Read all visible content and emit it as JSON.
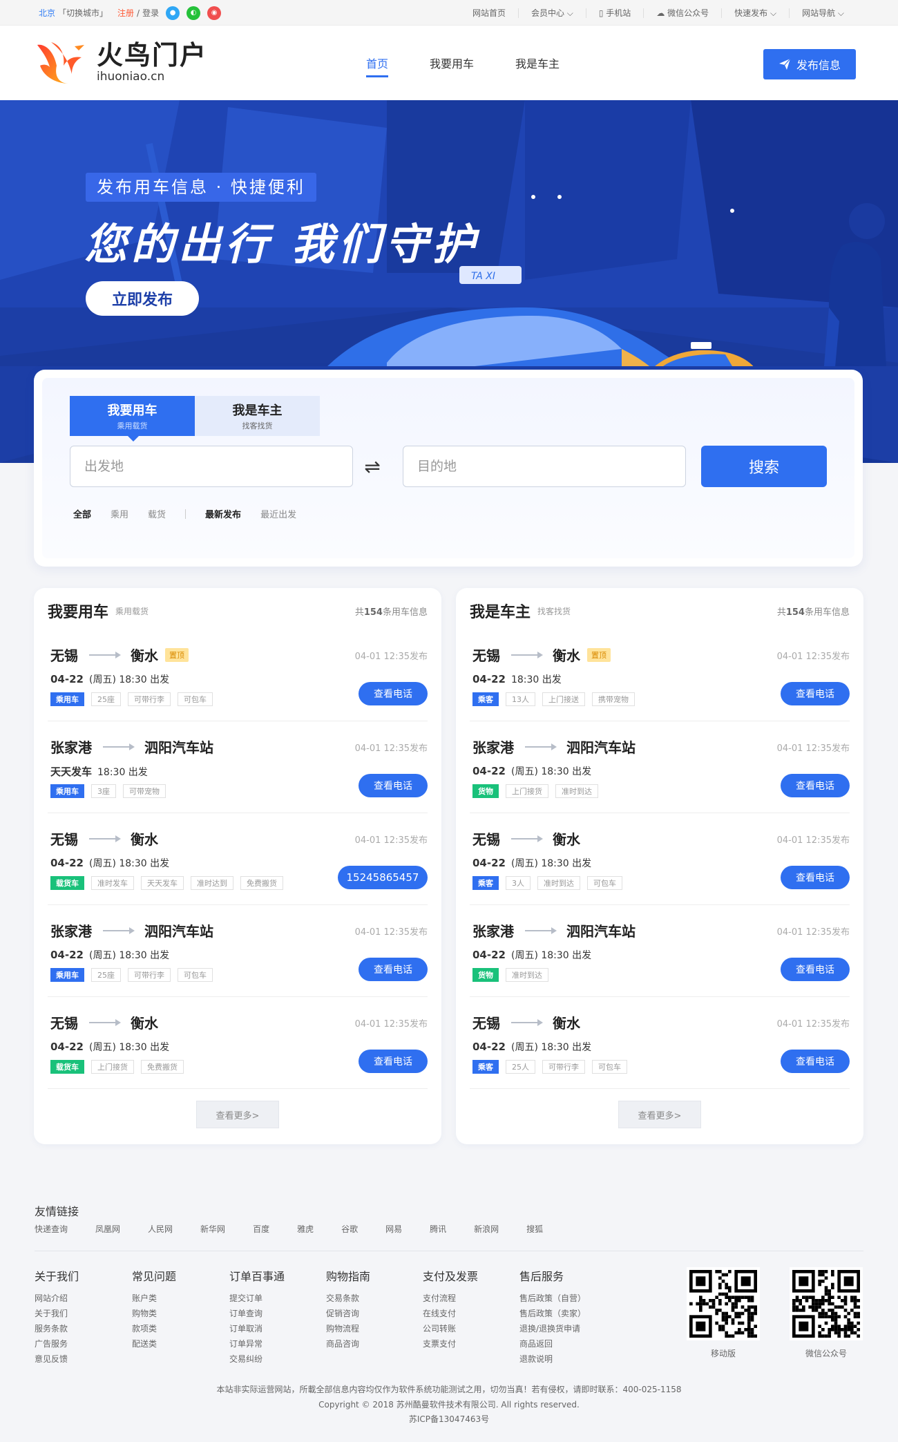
{
  "topbar": {
    "city": "北京",
    "switch_city": "「切换城市」",
    "register": "注册",
    "slash": "/",
    "login": "登录",
    "links": [
      "网站首页",
      "会员中心 ⌵",
      "手机站",
      "微信公众号",
      "快速发布 ⌵",
      "网站导航 ⌵"
    ]
  },
  "header": {
    "logo_main": "火鸟门户",
    "logo_sub": "ihuoniao.cn",
    "nav": [
      "首页",
      "我要用车",
      "我是车主"
    ],
    "publish_button": "发布信息"
  },
  "banner": {
    "tag": "发布用车信息 · 快捷便利",
    "title": "您的出行 我们守护",
    "button": "立即发布",
    "taxi_sign": "TA XI"
  },
  "search": {
    "tab_active_title": "我要用车",
    "tab_active_sub": "乘用载货",
    "tab_other_title": "我是车主",
    "tab_other_sub": "找客找货",
    "from_placeholder": "出发地",
    "to_placeholder": "目的地",
    "swap_icon": "⇌",
    "button": "搜索",
    "filters_type": [
      "全部",
      "乘用",
      "载货"
    ],
    "filters_sort": [
      "最新发布",
      "最近出发"
    ]
  },
  "left_panel": {
    "title": "我要用车",
    "subtitle": "乘用载货",
    "count_pre": "共",
    "count": "154",
    "count_post": "条用车信息",
    "more": "查看更多>",
    "rows": [
      {
        "from": "无锡",
        "to": "衡水",
        "top": "置顶",
        "time": "04-01  12:35发布",
        "date": "04-22",
        "detail": "(周五) 18:30 出发",
        "type": "乘用车",
        "type_color": "blue",
        "tags": [
          "25座",
          "可带行李",
          "可包车"
        ],
        "btn": "查看电话",
        "wide": false
      },
      {
        "from": "张家港",
        "to": "泗阳汽车站",
        "top": "",
        "time": "04-01  12:35发布",
        "date": "天天发车",
        "detail": "18:30 出发",
        "type": "乘用车",
        "type_color": "blue",
        "tags": [
          "3座",
          "可带宠物"
        ],
        "btn": "查看电话",
        "wide": false
      },
      {
        "from": "无锡",
        "to": "衡水",
        "top": "",
        "time": "04-01  12:35发布",
        "date": "04-22",
        "detail": "(周五) 18:30 出发",
        "type": "载货车",
        "type_color": "green",
        "tags": [
          "准时发车",
          "天天发车",
          "准时达到",
          "免费搬货"
        ],
        "btn": "15245865457",
        "wide": true
      },
      {
        "from": "张家港",
        "to": "泗阳汽车站",
        "top": "",
        "time": "04-01  12:35发布",
        "date": "04-22",
        "detail": "(周五) 18:30 出发",
        "type": "乘用车",
        "type_color": "blue",
        "tags": [
          "25座",
          "可带行李",
          "可包车"
        ],
        "btn": "查看电话",
        "wide": false
      },
      {
        "from": "无锡",
        "to": "衡水",
        "top": "",
        "time": "04-01  12:35发布",
        "date": "04-22",
        "detail": "(周五) 18:30 出发",
        "type": "载货车",
        "type_color": "green",
        "tags": [
          "上门接货",
          "免费搬货"
        ],
        "btn": "查看电话",
        "wide": false
      }
    ]
  },
  "right_panel": {
    "title": "我是车主",
    "subtitle": "找客找货",
    "count_pre": "共",
    "count": "154",
    "count_post": "条用车信息",
    "more": "查看更多>",
    "rows": [
      {
        "from": "无锡",
        "to": "衡水",
        "top": "置顶",
        "time": "04-01  12:35发布",
        "date": "04-22",
        "detail": "18:30 出发",
        "type": "乘客",
        "type_color": "blue",
        "tags": [
          "13人",
          "上门接送",
          "携带宠物"
        ],
        "btn": "查看电话",
        "wide": false
      },
      {
        "from": "张家港",
        "to": "泗阳汽车站",
        "top": "",
        "time": "04-01  12:35发布",
        "date": "04-22",
        "detail": "(周五) 18:30 出发",
        "type": "货物",
        "type_color": "green",
        "tags": [
          "上门接货",
          "准时到达"
        ],
        "btn": "查看电话",
        "wide": false
      },
      {
        "from": "无锡",
        "to": "衡水",
        "top": "",
        "time": "04-01  12:35发布",
        "date": "04-22",
        "detail": "(周五) 18:30 出发",
        "type": "乘客",
        "type_color": "blue",
        "tags": [
          "3人",
          "准时到达",
          "可包车"
        ],
        "btn": "查看电话",
        "wide": false
      },
      {
        "from": "张家港",
        "to": "泗阳汽车站",
        "top": "",
        "time": "04-01  12:35发布",
        "date": "04-22",
        "detail": "(周五) 18:30 出发",
        "type": "货物",
        "type_color": "green",
        "tags": [
          "准时到达"
        ],
        "btn": "查看电话",
        "wide": false
      },
      {
        "from": "无锡",
        "to": "衡水",
        "top": "",
        "time": "04-01  12:35发布",
        "date": "04-22",
        "detail": "(周五) 18:30 出发",
        "type": "乘客",
        "type_color": "blue",
        "tags": [
          "25人",
          "可带行李",
          "可包车"
        ],
        "btn": "查看电话",
        "wide": false
      }
    ]
  },
  "footer": {
    "friend_links_title": "友情链接",
    "friend_links": [
      "快递查询",
      "凤凰网",
      "人民网",
      "新华网",
      "百度",
      "雅虎",
      "谷歌",
      "网易",
      "腾讯",
      "新浪网",
      "搜狐"
    ],
    "columns": [
      {
        "title": "关于我们",
        "items": [
          "网站介绍",
          "关于我们",
          "服务条款",
          "广告服务",
          "意见反馈"
        ]
      },
      {
        "title": "常见问题",
        "items": [
          "账户类",
          "购物类",
          "款项类",
          "配送类"
        ]
      },
      {
        "title": "订单百事通",
        "items": [
          "提交订单",
          "订单查询",
          "订单取消",
          "订单异常",
          "交易纠纷"
        ]
      },
      {
        "title": "购物指南",
        "items": [
          "交易条款",
          "促销咨询",
          "购物流程",
          "商品咨询"
        ]
      },
      {
        "title": "支付及发票",
        "items": [
          "支付流程",
          "在线支付",
          "公司转账",
          "支票支付"
        ]
      },
      {
        "title": "售后服务",
        "items": [
          "售后政策（自营）",
          "售后政策（卖家）",
          "退换/退换货申请",
          "商品返回",
          "退款说明"
        ]
      }
    ],
    "qr_mobile": "移动版",
    "qr_wechat": "微信公众号",
    "disclaimer": "本站非实际运营网站，所載全部信息内容均仅作为软件系统功能测试之用，切勿当真！若有侵权，请即时联系：400-025-1158",
    "copyright": "Copyright © 2018 苏州酷曼软件技术有限公司. All rights reserved.",
    "icp": "苏ICP备13047463号"
  },
  "colors": {
    "primary": "#2f6ff0",
    "green": "#19c17a",
    "orange": "#ff5a36",
    "top_badge": "#ffe39a"
  }
}
